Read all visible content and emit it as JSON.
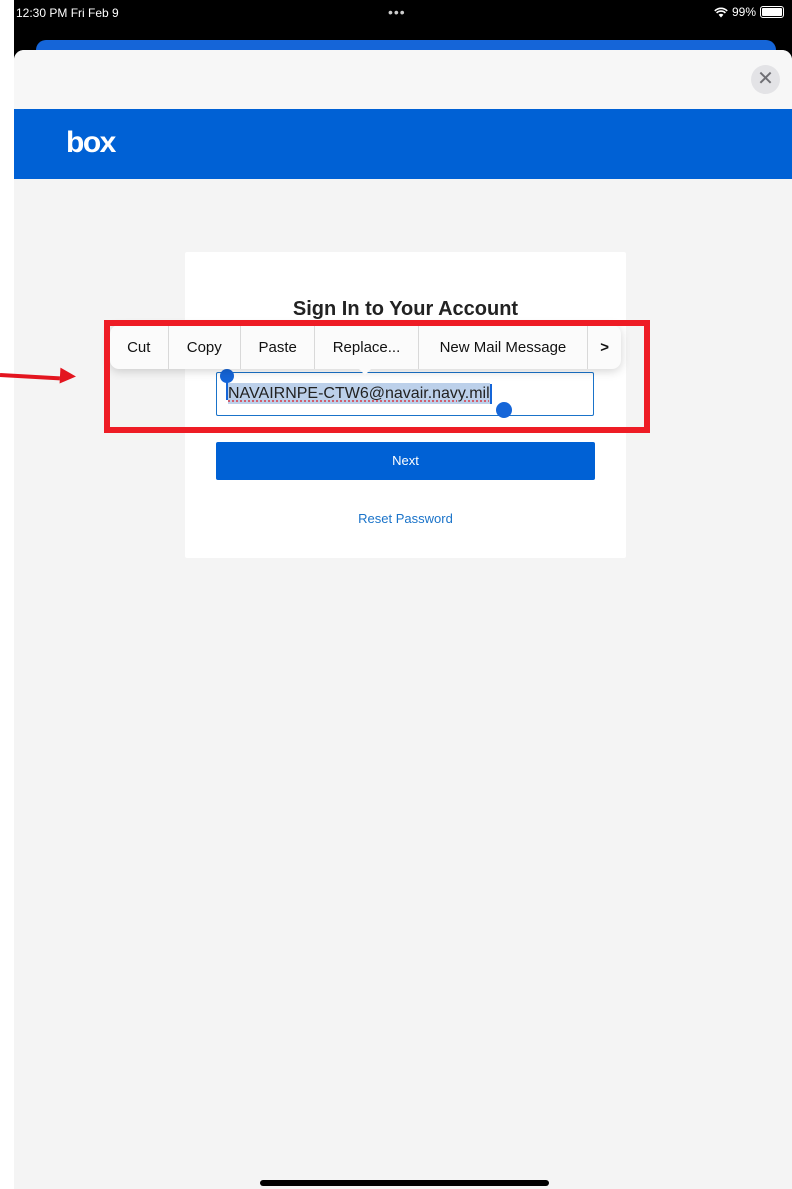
{
  "status_bar": {
    "time_date": "12:30 PM  Fri Feb 9",
    "dots": "•••",
    "battery": "99%",
    "battery_level": 0.99
  },
  "sheet": {
    "close_glyph": "✕"
  },
  "header": {
    "logo_text": "box"
  },
  "login": {
    "title": "Sign In to Your Account",
    "email_value": "NAVAIRNPE-CTW6@navair.navy.mil",
    "next_label": "Next",
    "reset_label": "Reset Password"
  },
  "context_menu": {
    "items": [
      "Cut",
      "Copy",
      "Paste",
      "Replace...",
      "New Mail Message"
    ],
    "more_glyph": ">"
  },
  "icons": {
    "wifi": "wifi-icon",
    "battery": "battery-icon",
    "close": "close-icon",
    "more": "chevron-right-icon"
  },
  "colors": {
    "brand": "#0061d5",
    "annotation": "#ee1c25",
    "selection": "#bcd0ea"
  }
}
